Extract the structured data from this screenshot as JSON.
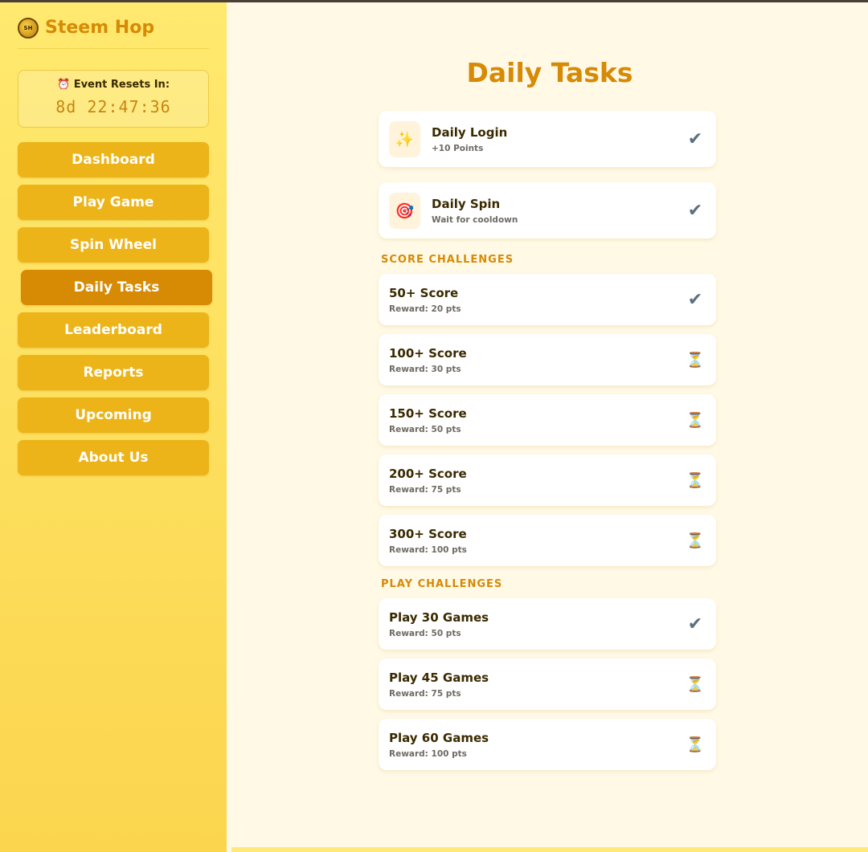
{
  "brand": {
    "name": "Steem Hop",
    "logo_icon": "steem-hop-coin-logo"
  },
  "timer": {
    "label": "⏰ Event Resets In:",
    "value": "8d 22:47:36"
  },
  "nav": [
    {
      "label": "Dashboard",
      "active": false
    },
    {
      "label": "Play Game",
      "active": false
    },
    {
      "label": "Spin Wheel",
      "active": false
    },
    {
      "label": "Daily Tasks",
      "active": true
    },
    {
      "label": "Leaderboard",
      "active": false
    },
    {
      "label": "Reports",
      "active": false
    },
    {
      "label": "Upcoming",
      "active": false
    },
    {
      "label": "About Us",
      "active": false
    }
  ],
  "page_title": "Daily Tasks",
  "daily": [
    {
      "icon": "✨",
      "icon_name": "sparkles-icon",
      "title": "Daily Login",
      "sub": "+10 Points",
      "status": "✔"
    },
    {
      "icon": "🎯",
      "icon_name": "target-icon",
      "title": "Daily Spin",
      "sub": "Wait for cooldown",
      "status": "✔"
    }
  ],
  "score_section": "SCORE CHALLENGES",
  "score": [
    {
      "title": "50+ Score",
      "sub": "Reward: 20 pts",
      "status": "✔",
      "done": true
    },
    {
      "title": "100+ Score",
      "sub": "Reward: 30 pts",
      "status": "⏳",
      "done": false
    },
    {
      "title": "150+ Score",
      "sub": "Reward: 50 pts",
      "status": "⏳",
      "done": false
    },
    {
      "title": "200+ Score",
      "sub": "Reward: 75 pts",
      "status": "⏳",
      "done": false
    },
    {
      "title": "300+ Score",
      "sub": "Reward: 100 pts",
      "status": "⏳",
      "done": false
    }
  ],
  "play_section": "PLAY CHALLENGES",
  "play": [
    {
      "title": "Play 30 Games",
      "sub": "Reward: 50 pts",
      "status": "✔",
      "done": true
    },
    {
      "title": "Play 45 Games",
      "sub": "Reward: 75 pts",
      "status": "⏳",
      "done": false
    },
    {
      "title": "Play 60 Games",
      "sub": "Reward: 100 pts",
      "status": "⏳",
      "done": false
    }
  ],
  "colors": {
    "accent": "#d68a06",
    "nav_bg": "#ecb418",
    "nav_active": "#d78b04",
    "page_bg": "#fff9e6"
  }
}
